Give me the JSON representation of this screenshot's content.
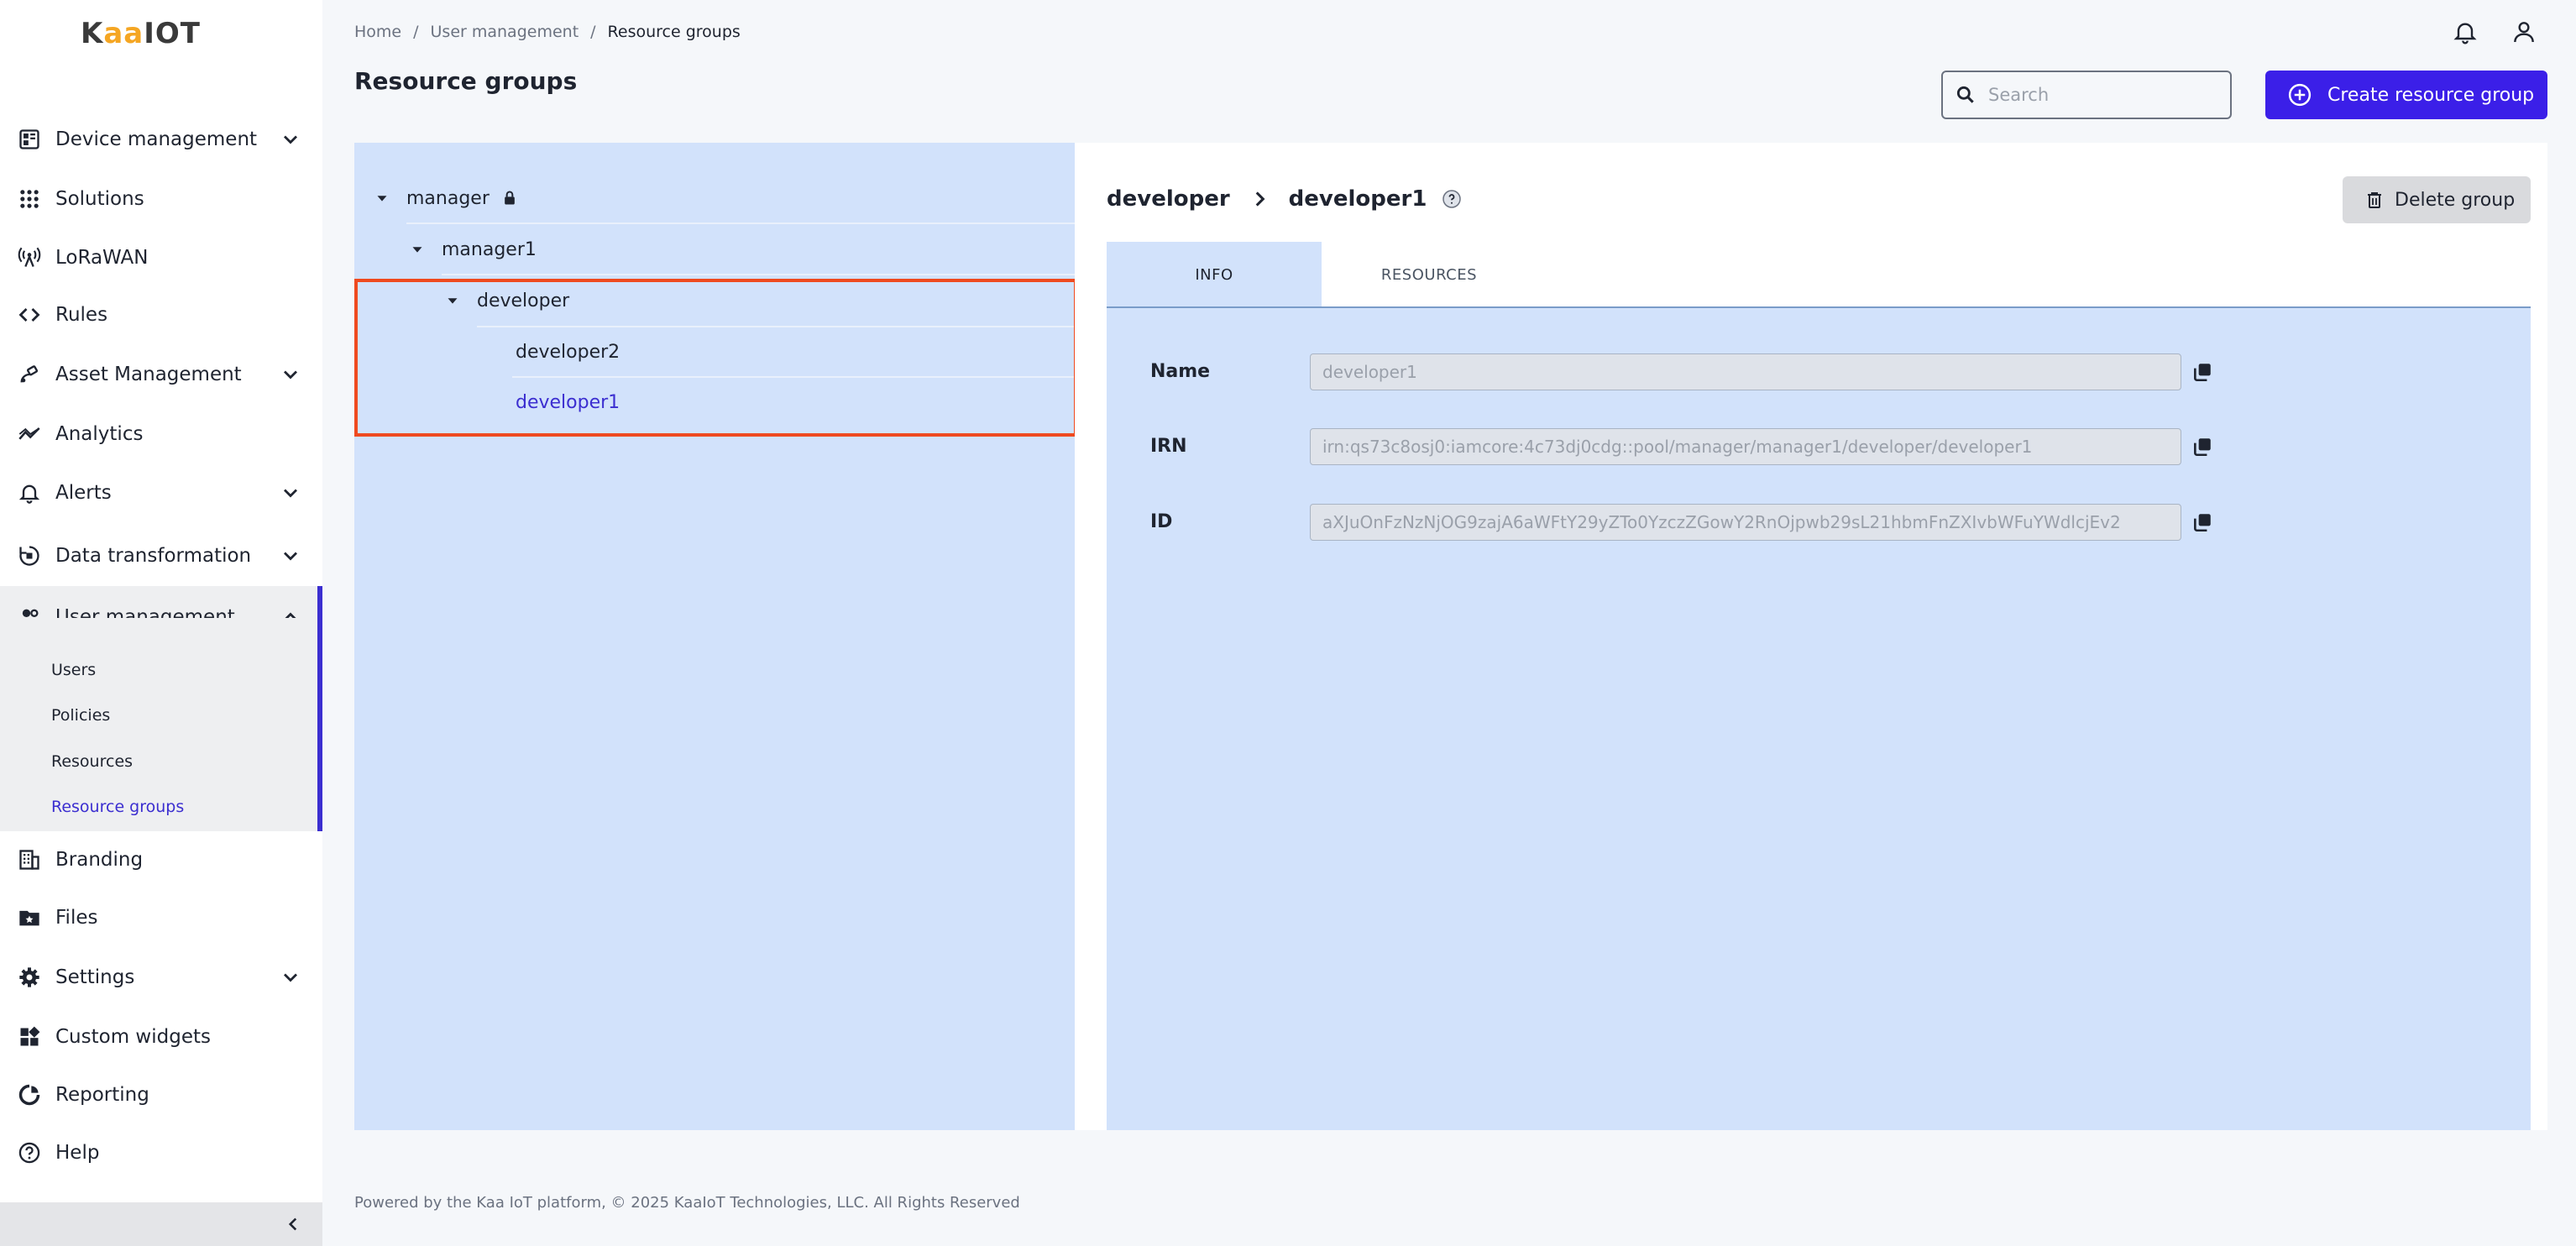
{
  "brand": {
    "logo_k": "K",
    "logo_aa": "aa",
    "logo_iot": "IOT"
  },
  "sidebar": {
    "items": [
      {
        "label": "Device management",
        "icon": "dashboard-icon",
        "expandable": true
      },
      {
        "label": "Solutions",
        "icon": "grid-icon",
        "expandable": false
      },
      {
        "label": "LoRaWAN",
        "icon": "antenna-icon",
        "expandable": false
      },
      {
        "label": "Rules",
        "icon": "code-icon",
        "expandable": false
      },
      {
        "label": "Asset Management",
        "icon": "satellite-icon",
        "expandable": true
      },
      {
        "label": "Analytics",
        "icon": "analytics-icon",
        "expandable": false
      },
      {
        "label": "Alerts",
        "icon": "bell-icon",
        "expandable": true
      },
      {
        "label": "Data transformation",
        "icon": "transform-icon",
        "expandable": true
      },
      {
        "label": "User management",
        "icon": "users-icon",
        "expandable": true,
        "expanded": true
      },
      {
        "label": "Branding",
        "icon": "building-icon",
        "expandable": false
      },
      {
        "label": "Files",
        "icon": "folder-star-icon",
        "expandable": false
      },
      {
        "label": "Settings",
        "icon": "gear-icon",
        "expandable": true
      },
      {
        "label": "Custom widgets",
        "icon": "widgets-icon",
        "expandable": false
      },
      {
        "label": "Reporting",
        "icon": "report-icon",
        "expandable": false
      },
      {
        "label": "Help",
        "icon": "help-icon",
        "expandable": false
      }
    ],
    "sub_items": [
      {
        "label": "Users",
        "selected": false
      },
      {
        "label": "Policies",
        "selected": false
      },
      {
        "label": "Resources",
        "selected": false
      },
      {
        "label": "Resource groups",
        "selected": true
      }
    ]
  },
  "header": {
    "breadcrumb": [
      "Home",
      "User management",
      "Resource groups"
    ],
    "breadcrumb_sep": "/",
    "title": "Resource groups",
    "search_placeholder": "Search",
    "search_value": "",
    "create_label": "Create resource group"
  },
  "tree": {
    "nodes": [
      {
        "label": "manager",
        "locked": true,
        "expanded": true,
        "level": 0
      },
      {
        "label": "manager1",
        "expanded": true,
        "level": 1
      },
      {
        "label": "developer",
        "expanded": true,
        "level": 2
      },
      {
        "label": "developer2",
        "level": 3
      },
      {
        "label": "developer1",
        "level": 3,
        "selected": true
      }
    ]
  },
  "detail": {
    "path_parent": "developer",
    "path_current": "developer1",
    "delete_label": "Delete group",
    "tabs": [
      {
        "label": "INFO",
        "active": true
      },
      {
        "label": "RESOURCES",
        "active": false
      }
    ],
    "fields": [
      {
        "label": "Name",
        "value": "developer1"
      },
      {
        "label": "IRN",
        "value": "irn:qs73c8osj0:iamcore:4c73dj0cdg::pool/manager/manager1/developer/developer1"
      },
      {
        "label": "ID",
        "value": "aXJuOnFzNzNjOG9zajA6aWFtY29yZTo0YzczZGowY2RnOjpwb29sL21hbmFnZXIvbWFuYWdlcjEv2"
      }
    ]
  },
  "footer": {
    "text": "Powered by the Kaa IoT platform, © 2025 KaaIoT Technologies, LLC. All Rights Reserved"
  },
  "colors": {
    "accent": "#3b1fe8",
    "selected_text": "#3b2ed0",
    "panel_bg": "#d2e2fb",
    "highlight_border": "#ef4a1f"
  }
}
